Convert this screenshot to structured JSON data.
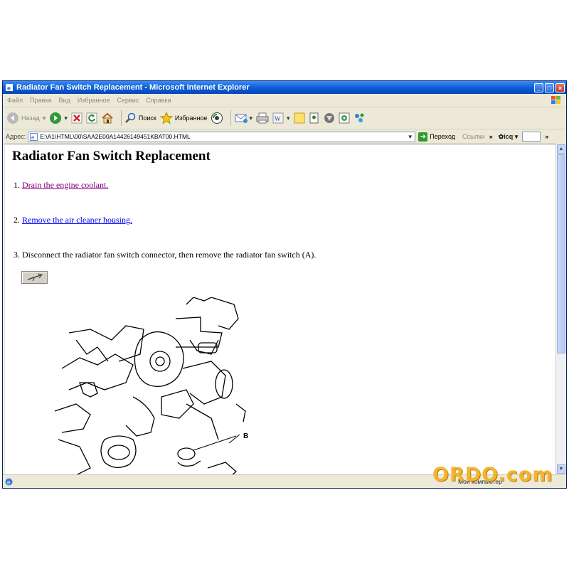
{
  "window": {
    "title": "Radiator Fan Switch Replacement - Microsoft Internet Explorer",
    "buttons": [
      "_",
      "□",
      "×"
    ]
  },
  "menu": [
    "Файл",
    "Правка",
    "Вид",
    "Избранное",
    "Сервис",
    "Справка"
  ],
  "toolbar": {
    "back_label": "Назад",
    "search_label": "Поиск",
    "favorites_label": "Избранное"
  },
  "address": {
    "label": "Адрес:",
    "url": "E:\\A1\\HTML\\00\\SAA2E00A14426149451KBAT00.HTML",
    "go_label": "Переход",
    "links_label": "Ссылки",
    "icq_label": "icq"
  },
  "page": {
    "title": "Radiator Fan Switch Replacement",
    "steps": [
      {
        "number": "1.",
        "text": "Drain the engine coolant.",
        "is_link": true,
        "visited": true
      },
      {
        "number": "2.",
        "text": "Remove the air cleaner housing.",
        "is_link": true,
        "visited": false
      },
      {
        "number": "3.",
        "text": "Disconnect the radiator fan switch connector, then remove the radiator fan switch (A).",
        "is_link": false
      }
    ],
    "diagram_label": "B"
  },
  "status": {
    "zone": "Мой компьютер"
  },
  "watermark": "ORDO.com"
}
